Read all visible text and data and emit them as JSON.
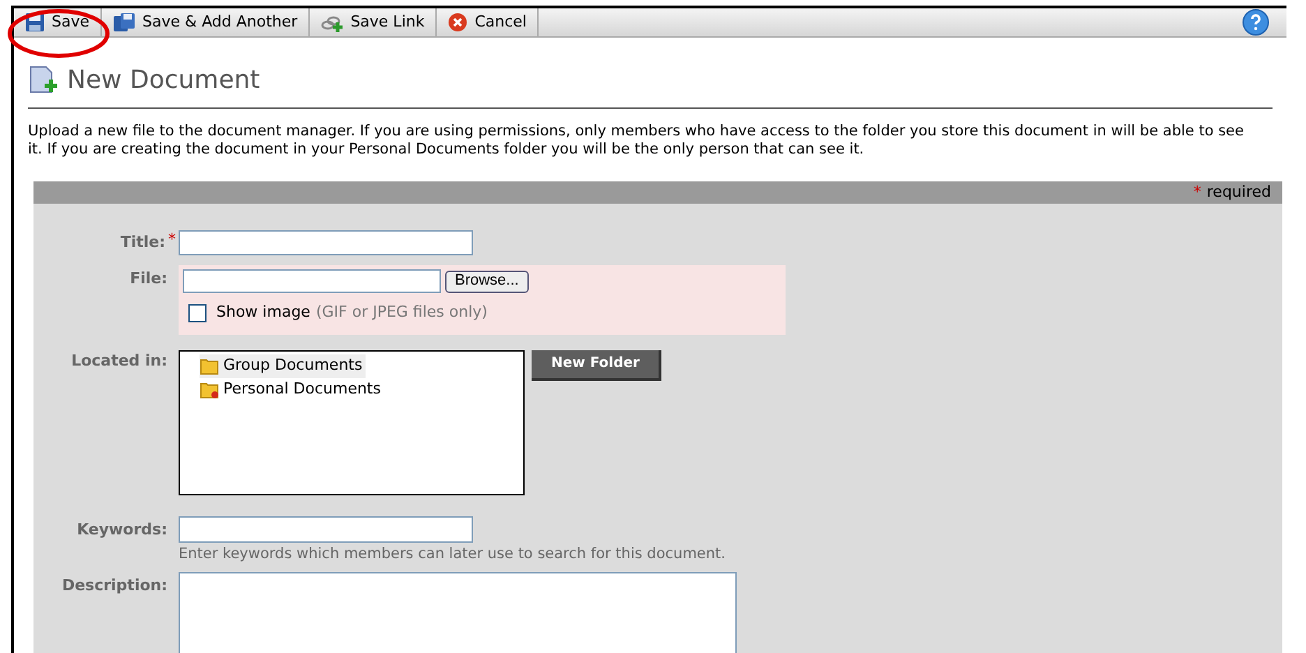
{
  "toolbar": {
    "buttons": [
      {
        "kind": "save",
        "label": "Save",
        "highlighted": true
      },
      {
        "kind": "save-add",
        "label": "Save & Add Another",
        "highlighted": false
      },
      {
        "kind": "link",
        "label": "Save Link",
        "highlighted": false
      },
      {
        "kind": "cancel",
        "label": "Cancel",
        "highlighted": false
      }
    ]
  },
  "page_title": "New Document",
  "intro": "Upload a new file to the document manager. If you are using permissions, only members who have access to the folder you store this document in will be able to see it. If you are creating the document in your Personal Documents folder you will be the only person that can see it.",
  "form": {
    "required_mark": "*",
    "required_note": "required",
    "title": {
      "label": "Title:",
      "required": true
    },
    "file": {
      "label": "File:",
      "browse": "Browse...",
      "show_image": {
        "label": "Show image",
        "note": "(GIF or JPEG files only)",
        "checked": false
      }
    },
    "located_in": {
      "label": "Located in:",
      "new_folder": "New Folder",
      "folders": [
        {
          "kind": "group",
          "name": "Group Documents",
          "selected": true
        },
        {
          "kind": "personal",
          "name": "Personal Documents",
          "selected": false
        }
      ]
    },
    "keywords": {
      "label": "Keywords:",
      "hint": "Enter keywords which members can later use to search for this document."
    },
    "description": {
      "label": "Description:"
    }
  }
}
